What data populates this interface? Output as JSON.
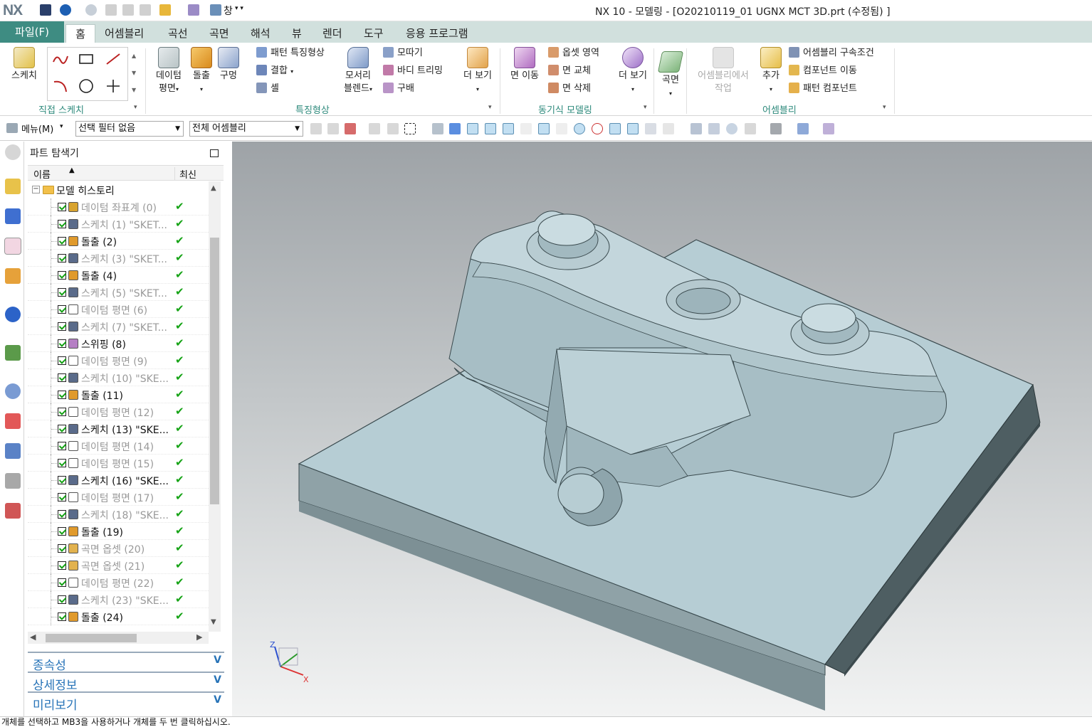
{
  "app": {
    "logo": "NX",
    "title": "NX 10 - 모델링 - [O20210119_01 UGNX MCT 3D.prt (수정됨) ]",
    "window_menu": "창"
  },
  "tabs": [
    "홈",
    "어셈블리",
    "곡선",
    "곡면",
    "해석",
    "뷰",
    "렌더",
    "도구",
    "응용 프로그램"
  ],
  "file_tab": "파일(F)",
  "active_tab": "홈",
  "ribbon": {
    "sketch": "스케치",
    "group_direct_sketch": "직접 스케치",
    "datum_plane": [
      "데이텀",
      "평면"
    ],
    "extrude": "돌출",
    "hole": "구멍",
    "pattern_feature": "패턴 특징형상",
    "unite": "결합",
    "shell": "셸",
    "edge_blend": [
      "모서리",
      "블렌드"
    ],
    "chamfer": "모따기",
    "trim_body": "바디 트리밍",
    "draft": "구배",
    "more_1": "더 보기",
    "group_feature": "특징형상",
    "move_face": "면 이동",
    "offset_region": "옵셋 영역",
    "replace_face": "면 교체",
    "delete_face": "면 삭제",
    "more_2": "더 보기",
    "group_sync": "동기식 모델링",
    "surface": "곡면",
    "work_in_assembly": [
      "어셈블리에서",
      "작업"
    ],
    "add": "추가",
    "assembly_constraints": "어셈블리 구속조건",
    "move_component": "컴포넌트 이동",
    "pattern_component": "패턴 컴포넌트",
    "group_assembly": "어셈블리"
  },
  "toolbar2": {
    "menu": "메뉴(M)",
    "selection_filter": "선택 필터 없음",
    "scope": "전체 어셈블리"
  },
  "navigator": {
    "title": "파트 탐색기",
    "col_name": "이름",
    "col_latest": "최신",
    "root": "모델 히스토리",
    "items": [
      {
        "label": "데이텀 좌표계 (0)",
        "icon": "datum-csys-icon",
        "dim": true
      },
      {
        "label": "스케치 (1) \"SKET...",
        "icon": "sketch-icon",
        "dim": true
      },
      {
        "label": "돌출 (2)",
        "icon": "extrude-icon",
        "dim": false
      },
      {
        "label": "스케치 (3) \"SKET...",
        "icon": "sketch-icon",
        "dim": true
      },
      {
        "label": "돌출 (4)",
        "icon": "extrude-icon",
        "dim": false
      },
      {
        "label": "스케치 (5) \"SKET...",
        "icon": "sketch-icon",
        "dim": true
      },
      {
        "label": "데이텀 평면 (6)",
        "icon": "datum-plane-icon",
        "dim": true
      },
      {
        "label": "스케치 (7) \"SKET...",
        "icon": "sketch-icon",
        "dim": true
      },
      {
        "label": "스위핑 (8)",
        "icon": "sweep-icon",
        "dim": false
      },
      {
        "label": "데이텀 평면 (9)",
        "icon": "datum-plane-icon",
        "dim": true
      },
      {
        "label": "스케치 (10) \"SKE...",
        "icon": "sketch-icon",
        "dim": true
      },
      {
        "label": "돌출 (11)",
        "icon": "extrude-icon",
        "dim": false
      },
      {
        "label": "데이텀 평면 (12)",
        "icon": "datum-plane-icon",
        "dim": true
      },
      {
        "label": "스케치 (13) \"SKE...",
        "icon": "sketch-icon",
        "dim": false
      },
      {
        "label": "데이텀 평면 (14)",
        "icon": "datum-plane-icon",
        "dim": true
      },
      {
        "label": "데이텀 평면 (15)",
        "icon": "datum-plane-icon",
        "dim": true
      },
      {
        "label": "스케치 (16) \"SKE...",
        "icon": "sketch-icon",
        "dim": false
      },
      {
        "label": "데이텀 평면 (17)",
        "icon": "datum-plane-icon",
        "dim": true
      },
      {
        "label": "스케치 (18) \"SKE...",
        "icon": "sketch-icon",
        "dim": true
      },
      {
        "label": "돌출 (19)",
        "icon": "extrude-icon",
        "dim": false
      },
      {
        "label": "곡면 옵셋 (20)",
        "icon": "offset-surface-icon",
        "dim": true
      },
      {
        "label": "곡면 옵셋 (21)",
        "icon": "offset-surface-icon",
        "dim": true
      },
      {
        "label": "데이텀 평면 (22)",
        "icon": "datum-plane-icon",
        "dim": true
      },
      {
        "label": "스케치 (23) \"SKE...",
        "icon": "sketch-icon",
        "dim": true
      },
      {
        "label": "돌출 (24)",
        "icon": "extrude-icon",
        "dim": false
      }
    ],
    "sections": [
      "종속성",
      "상세정보",
      "미리보기"
    ]
  },
  "triad": {
    "x": "X",
    "y": "Y",
    "z": "Z"
  },
  "status": "개체를 선택하고 MB3을 사용하거나 개체를 두 번 클릭하십시오.",
  "colors": {
    "accent": "#3e8c82",
    "tab_bg": "#d1e0dd",
    "group_label": "#2e8a7c",
    "section_link": "#2874b8",
    "check_green": "#16a316",
    "model_face": "#b4ccd3",
    "model_side": "#53666b"
  }
}
